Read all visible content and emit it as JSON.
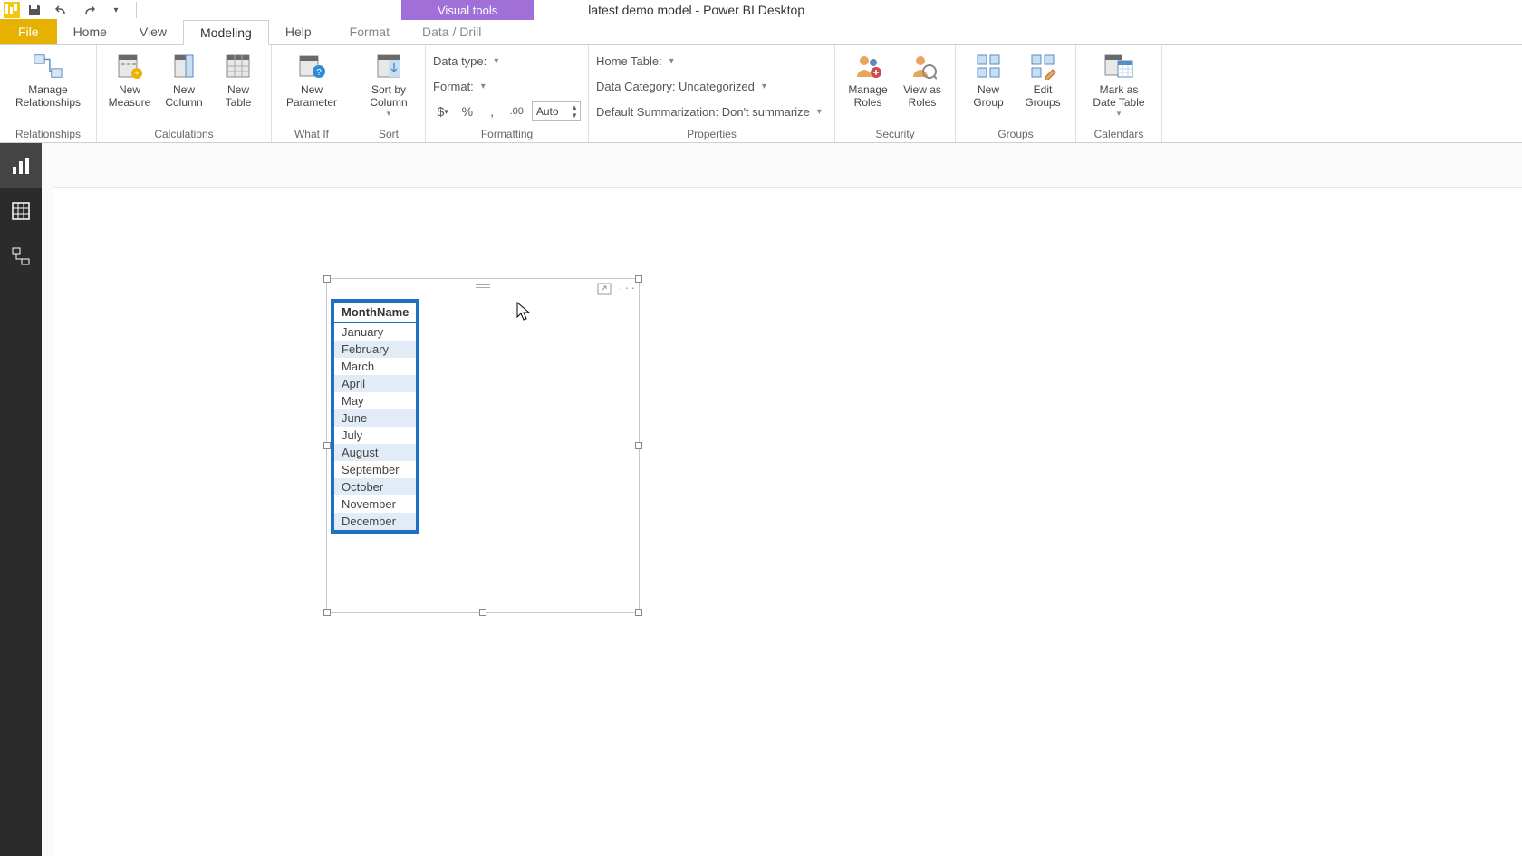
{
  "title": "latest demo model - Power BI Desktop",
  "contextual_tab": "Visual tools",
  "tabs": {
    "file": "File",
    "home": "Home",
    "view": "View",
    "modeling": "Modeling",
    "help": "Help",
    "format": "Format",
    "datadrill": "Data / Drill"
  },
  "ribbon": {
    "relationships": {
      "manage": "Manage\nRelationships",
      "group": "Relationships"
    },
    "calculations": {
      "measure": "New\nMeasure",
      "column": "New\nColumn",
      "table": "New\nTable",
      "group": "Calculations"
    },
    "whatif": {
      "param": "New\nParameter",
      "group": "What If"
    },
    "sort": {
      "sort": "Sort by\nColumn",
      "group": "Sort"
    },
    "formatting": {
      "datatype": "Data type:",
      "format": "Format:",
      "auto": "Auto",
      "group": "Formatting"
    },
    "properties": {
      "hometable": "Home Table:",
      "datacat": "Data Category: Uncategorized",
      "defsum": "Default Summarization: Don't summarize",
      "group": "Properties"
    },
    "security": {
      "manage": "Manage\nRoles",
      "viewas": "View as\nRoles",
      "group": "Security"
    },
    "groups": {
      "newg": "New\nGroup",
      "editg": "Edit\nGroups",
      "group": "Groups"
    },
    "calendars": {
      "mark": "Mark as\nDate Table",
      "group": "Calendars"
    }
  },
  "table": {
    "header": "MonthName",
    "rows": [
      "January",
      "February",
      "March",
      "April",
      "May",
      "June",
      "July",
      "August",
      "September",
      "October",
      "November",
      "December"
    ]
  }
}
